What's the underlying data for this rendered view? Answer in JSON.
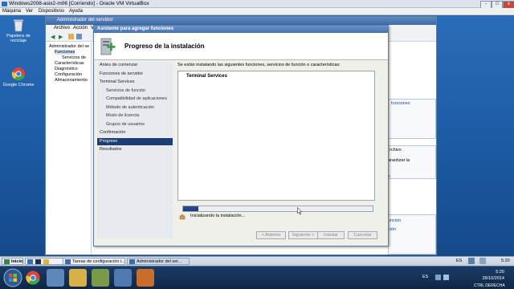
{
  "host": {
    "title": "Windows2008-asix2-m06 [Corriendo] - Oracle VM VirtualBox",
    "menu": [
      "Máquina",
      "Ver",
      "Dispositivos",
      "Ayuda"
    ],
    "window_buttons": [
      "-",
      "□",
      "x"
    ]
  },
  "desktop": {
    "icons": [
      {
        "label1": "Papelera de",
        "label2": "reciclaje",
        "icon": "recycle-bin-icon"
      },
      {
        "label1": "Google Chrome",
        "label2": "",
        "icon": "chrome-icon"
      }
    ]
  },
  "server_manager": {
    "title": "Administrador del servidor",
    "menu": [
      "Archivo",
      "Acción",
      "Ver"
    ],
    "tree": [
      {
        "label": "Administrador del se"
      },
      {
        "label": "Funciones"
      },
      {
        "label": "Servicios de"
      },
      {
        "label": "Características"
      },
      {
        "label": "Diagnóstico"
      },
      {
        "label": "Configuración"
      },
      {
        "label": "Almacenamiento"
      }
    ],
    "right_panel": {
      "link1": "funciones",
      "text1": "rchivo",
      "text2": "arantizar la",
      "link2": "s",
      "link3": "uncion",
      "link4": "ción"
    }
  },
  "wizard": {
    "title": "Asistente para agregar funciones",
    "header": "Progreso de la instalación",
    "nav": [
      {
        "label": "Antes de comenzar",
        "sub": false,
        "active": false
      },
      {
        "label": "Funciones de servidor",
        "sub": false,
        "active": false
      },
      {
        "label": "Terminal Services",
        "sub": false,
        "active": false
      },
      {
        "label": "Servicios de función",
        "sub": true,
        "active": false
      },
      {
        "label": "Compatibilidad de aplicaciones",
        "sub": true,
        "active": false
      },
      {
        "label": "Método de autenticación",
        "sub": true,
        "active": false
      },
      {
        "label": "Modo de licencia",
        "sub": true,
        "active": false
      },
      {
        "label": "Grupos de usuarios",
        "sub": true,
        "active": false
      },
      {
        "label": "Confirmación",
        "sub": false,
        "active": false
      },
      {
        "label": "Progreso",
        "sub": false,
        "active": true
      },
      {
        "label": "Resultados",
        "sub": false,
        "active": false
      }
    ],
    "intro": "Se están instalando las siguientes funciones, servicios de función o características:",
    "feature_header": "Terminal Services",
    "progress": 0.08,
    "status": "Inicializando la instalación...",
    "buttons": {
      "prev": "< Anterior",
      "next": "Siguiente >",
      "install": "Instalar",
      "cancel": "Cancelar"
    }
  },
  "guest_taskbar": {
    "start": "Inicio",
    "tasks": [
      {
        "label": "Tareas de configuración i...",
        "active": false
      },
      {
        "label": "Administrador del ser...",
        "active": true
      }
    ],
    "lang": "ES",
    "time": "5:20"
  },
  "host_taskbar": {
    "lang": "ES",
    "time": "5:20",
    "date": "28/10/2014",
    "hostkey": "CTRL DERECHA"
  }
}
